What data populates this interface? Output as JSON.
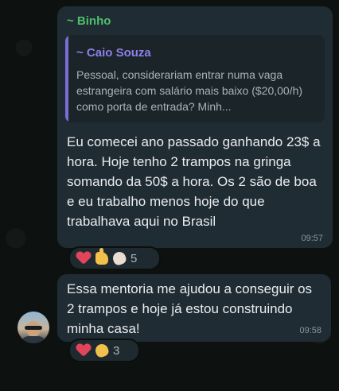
{
  "message1": {
    "sender": "~ Binho",
    "quote": {
      "author": "~ Caio Souza",
      "text": "Pessoal, considerariam entrar numa vaga estrangeira com salário mais baixo ($20,00/h) como porta de entrada? Minh..."
    },
    "text": "Eu comecei ano passado ganhando 23$ a hora. Hoje tenho 2 trampos na gringa somando da 50$ a hora. Os 2 são de boa e eu trabalho menos hoje do que trabalhava aqui no Brasil",
    "time": "09:57",
    "reactions": {
      "emojis": [
        "heart-icon",
        "thumbs-up-icon",
        "clap-icon"
      ],
      "count": "5"
    }
  },
  "message2": {
    "text": "Essa mentoria me ajudou a conseguir os 2 trampos e hoje já estou construindo minha casa!",
    "time": "09:58",
    "reactions": {
      "emojis": [
        "heart-icon",
        "clap-icon"
      ],
      "count": "3"
    }
  },
  "colors": {
    "bubble": "#202c33",
    "sender_name": "#4fbf6b",
    "quote_author": "#8f7fe8",
    "background": "#0b0f0e"
  }
}
